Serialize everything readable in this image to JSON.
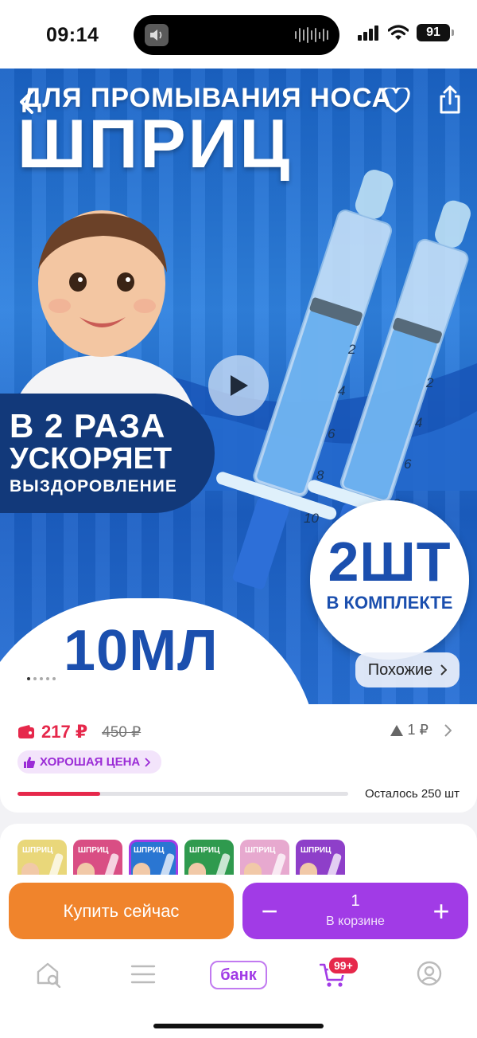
{
  "status_bar": {
    "time": "09:14",
    "battery": "91"
  },
  "hero": {
    "caption_top": "ДЛЯ ПРОМЫВАНИЯ НОСА",
    "title": "ШПРИЦ",
    "badge_line1": "В 2 РАЗА",
    "badge_line2": "УСКОРЯЕТ",
    "badge_line3": "ВЫЗДОРОВЛЕНИЕ",
    "qty_number": "2ШТ",
    "qty_sub": "В КОМПЛЕКТЕ",
    "volume": "10МЛ",
    "scale_marks": [
      "2",
      "4",
      "6",
      "8",
      "10"
    ],
    "similar_label": "Похожие",
    "carousel": {
      "count": 5,
      "active": 0
    },
    "icons": {
      "back": "chevron-left-icon",
      "favorite": "heart-icon",
      "share": "share-icon",
      "play": "play-icon"
    }
  },
  "price": {
    "current": "217 ₽",
    "old": "450 ₽",
    "bonus": "1 ₽",
    "good_price_label": "ХОРОШАЯ ЦЕНА",
    "stock_text": "Осталось 250 шт",
    "stock_level": 0.25
  },
  "variants": {
    "items": [
      {
        "label": "ШПРИЦ",
        "color": "#e9d77a"
      },
      {
        "label": "ШПРИЦ",
        "color": "#d94e84"
      },
      {
        "label": "ШПРИЦ",
        "color": "#2a76d2"
      },
      {
        "label": "ШПРИЦ",
        "color": "#2f9a4e"
      },
      {
        "label": "ШПРИЦ",
        "color": "#e7a9cf"
      },
      {
        "label": "ШПРИЦ",
        "color": "#8e3fc9"
      }
    ],
    "selected": 2
  },
  "actions": {
    "buy_label": "Купить сейчас",
    "cart_qty": "1",
    "cart_label": "В корзине",
    "minus": "−",
    "plus": "+"
  },
  "nav": {
    "bank_label": "банк",
    "cart_badge": "99+"
  },
  "colors": {
    "accent": "#a13be6",
    "buy": "#f0842c",
    "price": "#e6284b"
  }
}
